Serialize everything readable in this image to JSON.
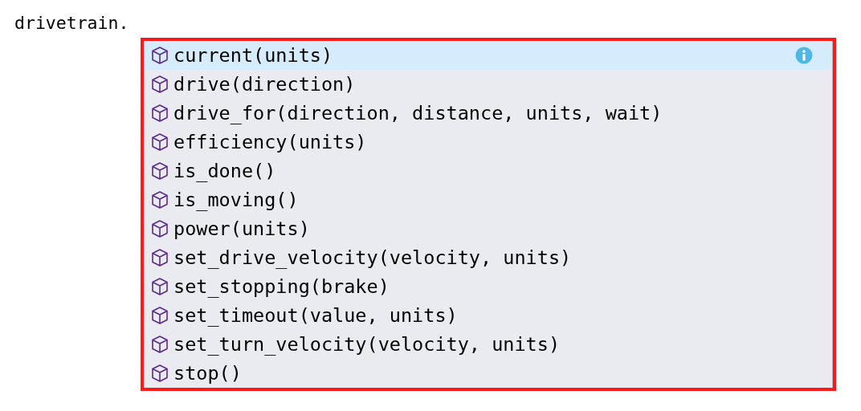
{
  "editor_text": "drivetrain.",
  "suggestions": [
    {
      "label": "current(units)",
      "selected": true
    },
    {
      "label": "drive(direction)",
      "selected": false
    },
    {
      "label": "drive_for(direction, distance, units, wait)",
      "selected": false
    },
    {
      "label": "efficiency(units)",
      "selected": false
    },
    {
      "label": "is_done()",
      "selected": false
    },
    {
      "label": "is_moving()",
      "selected": false
    },
    {
      "label": "power(units)",
      "selected": false
    },
    {
      "label": "set_drive_velocity(velocity, units)",
      "selected": false
    },
    {
      "label": "set_stopping(brake)",
      "selected": false
    },
    {
      "label": "set_timeout(value, units)",
      "selected": false
    },
    {
      "label": "set_turn_velocity(velocity, units)",
      "selected": false
    },
    {
      "label": "stop()",
      "selected": false
    }
  ]
}
